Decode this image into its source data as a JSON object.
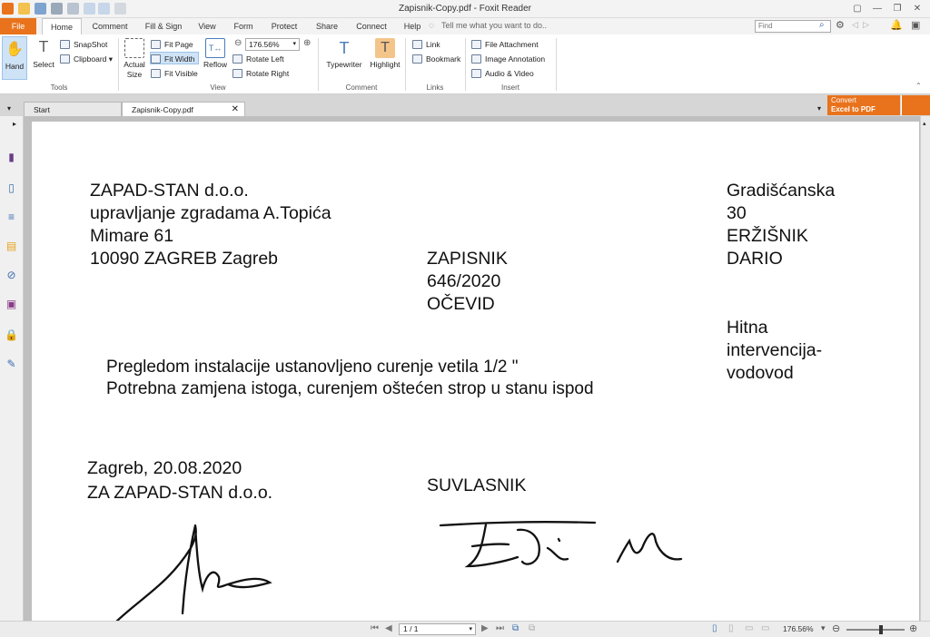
{
  "window": {
    "title": "Zapisnik-Copy.pdf - Foxit Reader",
    "controls": [
      "▢",
      "—",
      "❐",
      "✕"
    ]
  },
  "ribbon_tabs": [
    "File",
    "Home",
    "Comment",
    "Fill & Sign",
    "View",
    "Form",
    "Protect",
    "Share",
    "Connect",
    "Help"
  ],
  "tell_me": "Tell me what you want to do..",
  "find_placeholder": "Find",
  "tools": {
    "hand": "Hand",
    "select": "Select",
    "snapshot": "SnapShot",
    "clipboard": "Clipboard",
    "group": "Tools"
  },
  "view": {
    "actual_size": "Actual Size",
    "fit_page": "Fit Page",
    "fit_width": "Fit Width",
    "fit_visible": "Fit Visible",
    "reflow": "Reflow",
    "zoom": "176.56%",
    "rotate_left": "Rotate Left",
    "rotate_right": "Rotate Right",
    "group": "View"
  },
  "comment": {
    "typewriter": "Typewriter",
    "highlight": "Highlight",
    "group": "Comment"
  },
  "links": {
    "link": "Link",
    "bookmark": "Bookmark",
    "group": "Links"
  },
  "insert": {
    "file_attachment": "File Attachment",
    "image_annotation": "Image Annotation",
    "audio_video": "Audio & Video",
    "group": "Insert"
  },
  "doc_tabs": {
    "start": "Start",
    "active": "Zapisnik-Copy.pdf"
  },
  "convert": {
    "line1": "Convert",
    "line2": "Excel to PDF"
  },
  "document": {
    "left_block": [
      "ZAPAD-STAN d.o.o.",
      "upravljanje zgradama A.Topića",
      "Mimare 61",
      "10090 ZAGREB Zagreb"
    ],
    "right_block": [
      "Gradišćanska",
      "30",
      "ERŽIŠNIK",
      "DARIO"
    ],
    "center_block": [
      "ZAPISNIK",
      "646/2020",
      "OČEVID"
    ],
    "right_note": [
      "Hitna",
      "intervencija-",
      "vodovod"
    ],
    "body": [
      "Pregledom instalacije ustanovljeno curenje vetila 1/2 \"",
      "Potrebna zamjena istoga, curenjem oštećen strop u stanu ispod"
    ],
    "date_line": "Zagreb, 20.08.2020",
    "company_sign": "ZA ZAPAD-STAN d.o.o.",
    "co_owner": "SUVLASNIK"
  },
  "status": {
    "page": "1 / 1",
    "zoom": "176.56%"
  },
  "colors": {
    "accent": "#e8731c",
    "selected": "#cfe3f7"
  }
}
